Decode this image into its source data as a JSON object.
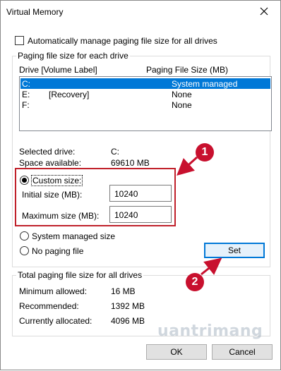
{
  "window": {
    "title": "Virtual Memory"
  },
  "auto_manage": {
    "label": "Automatically manage paging file size for all drives",
    "checked": false
  },
  "drives_group": {
    "legend": "Paging file size for each drive",
    "col_drive": "Drive  [Volume Label]",
    "col_size": "Paging File Size (MB)",
    "rows": [
      {
        "drive": "C:",
        "label": "",
        "size": "System managed",
        "selected": true
      },
      {
        "drive": "E:",
        "label": "[Recovery]",
        "size": "None",
        "selected": false
      },
      {
        "drive": "F:",
        "label": "",
        "size": "None",
        "selected": false
      }
    ]
  },
  "selected_info": {
    "selected_drive_label": "Selected drive:",
    "selected_drive_value": "C:",
    "space_label": "Space available:",
    "space_value": "69610 MB"
  },
  "custom": {
    "label": "Custom size:",
    "initial_label": "Initial size (MB):",
    "initial_value": "10240",
    "max_label": "Maximum size (MB):",
    "max_value": "10240"
  },
  "system_managed": {
    "label": "System managed size"
  },
  "no_paging": {
    "label": "No paging file"
  },
  "set_button": "Set",
  "totals": {
    "legend": "Total paging file size for all drives",
    "min_label": "Minimum allowed:",
    "min_value": "16 MB",
    "rec_label": "Recommended:",
    "rec_value": "1392 MB",
    "cur_label": "Currently allocated:",
    "cur_value": "4096 MB"
  },
  "ok_button": "OK",
  "cancel_button": "Cancel",
  "annotations": {
    "badge1": "1",
    "badge2": "2",
    "accent": "#c8102e"
  },
  "watermark": "uantrimang"
}
